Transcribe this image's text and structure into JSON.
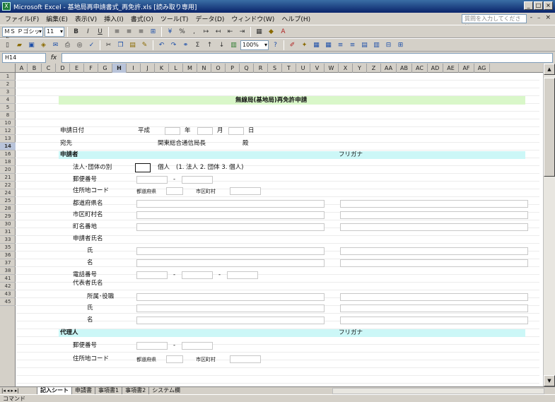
{
  "window": {
    "title": "Microsoft Excel - 基地局再申請書式_再免許.xls [読み取り専用]",
    "controls": [
      "_",
      "□",
      "×"
    ]
  },
  "menubar": {
    "items": [
      "ファイル(F)",
      "編集(E)",
      "表示(V)",
      "挿入(I)",
      "書式(O)",
      "ツール(T)",
      "データ(D)",
      "ウィンドウ(W)",
      "ヘルプ(H)"
    ],
    "help_placeholder": "質問を入力してください",
    "help_controls": "- ₋ × "
  },
  "toolbar1": {
    "font_name": "ＭＳ Ｐゴシック",
    "font_size": "11",
    "icons": [
      "bold-icon",
      "italic-icon",
      "underline-icon",
      "align-left-icon",
      "align-center-icon",
      "align-right-icon",
      "merge-center-icon",
      "currency-icon",
      "percent-icon",
      "comma-icon",
      "increase-decimal-icon",
      "decrease-decimal-icon",
      "decrease-indent-icon",
      "increase-indent-icon",
      "borders-icon",
      "fill-color-icon",
      "font-color-icon"
    ]
  },
  "toolbar2": {
    "zoom": "100%",
    "icons": [
      "new-icon",
      "open-icon",
      "save-icon",
      "permission-icon",
      "email-icon",
      "print-icon",
      "print-preview-icon",
      "spelling-icon",
      "cut-icon",
      "copy-icon",
      "paste-icon",
      "format-painter-icon",
      "undo-icon",
      "redo-icon",
      "hyperlink-icon",
      "autosum-icon",
      "sort-asc-icon",
      "sort-desc-icon",
      "chart-wizard-icon",
      "drawing-icon",
      "help-icon"
    ]
  },
  "formula": {
    "name_box": "H14",
    "fx_label": "fx",
    "value": ""
  },
  "columns": [
    "A",
    "B",
    "C",
    "D",
    "E",
    "F",
    "G",
    "H",
    "I",
    "J",
    "K",
    "L",
    "M",
    "N",
    "O",
    "P",
    "Q",
    "R",
    "S",
    "T",
    "U",
    "V",
    "W",
    "X",
    "Y",
    "Z",
    "AA",
    "AB",
    "AC",
    "AD",
    "AE",
    "AF",
    "AG"
  ],
  "selected_column": "H",
  "rows": [
    "1",
    "2",
    "3",
    "4",
    "5",
    "8",
    "10",
    "12",
    "13",
    "14",
    "16",
    "18",
    "20",
    "21",
    "22",
    "24",
    "25",
    "28",
    "29",
    "30",
    "31",
    "33",
    "35",
    "36",
    "37",
    "38",
    "41",
    "42",
    "43",
    "45"
  ],
  "selected_row": "14",
  "form": {
    "title": "無線局(基地局)再免許申請",
    "date_label": "申請日付",
    "era": "平成",
    "year": "年",
    "month": "月",
    "day": "日",
    "to_label": "宛先",
    "recipient": "関東総合通信局長",
    "honorific": "殿",
    "applicant_section": "申請者",
    "furigana": "フリガナ",
    "entity_type_label": "法人･団体の別",
    "entity_value": "個人",
    "entity_options": "(1. 法人 2. 団体 3. 個人)",
    "postal_label": "郵便番号",
    "dash": "-",
    "address_code_label": "住所地コード",
    "prefecture_small": "都道府県",
    "city_small": "市区町村",
    "prefecture_label": "都道府県名",
    "city_label": "市区町村名",
    "street_label": "町名番地",
    "applicant_name_label": "申請者氏名",
    "surname_label": "氏",
    "given_label": "名",
    "phone_label": "電話番号",
    "rep_name_label": "代表者氏名",
    "position_label": "所属･役職",
    "rep_surname_label": "氏",
    "rep_given_label": "名",
    "agent_section": "代理人",
    "agent_furigana": "フリガナ",
    "agent_postal_label": "郵便番号",
    "agent_address_code_label": "住所地コード",
    "agent_prefecture_small": "都道府県",
    "agent_city_small": "市区町村"
  },
  "sheet_tabs": [
    "記入シート",
    "申請書",
    "事項書1",
    "事項書2",
    "システム欄"
  ],
  "active_tab": "記入シート",
  "status": "コマンド",
  "colors": {
    "title_band": "#d9f7c9",
    "section_band": "#ccf7f7",
    "selection": "#b9c4da"
  }
}
